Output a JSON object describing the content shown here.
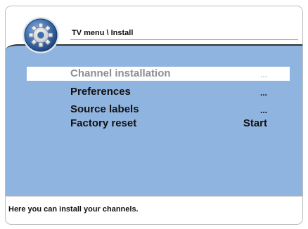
{
  "header": {
    "breadcrumb": "TV menu \\ Install",
    "icon": "settings-gear-icon"
  },
  "menu": {
    "items": [
      {
        "label": "Channel installation",
        "value": "...",
        "selected": true
      },
      {
        "label": "Preferences",
        "value": "...",
        "selected": false
      },
      {
        "label": "Source labels",
        "value": "...",
        "selected": false
      },
      {
        "label": "Factory reset",
        "value": "Start",
        "selected": false
      }
    ]
  },
  "footer": {
    "help_text": "Here you can install your channels."
  },
  "colors": {
    "panel": "#8fb4df",
    "selection": "#ffffff",
    "selected_text": "#8a8f96",
    "text": "#111111"
  }
}
